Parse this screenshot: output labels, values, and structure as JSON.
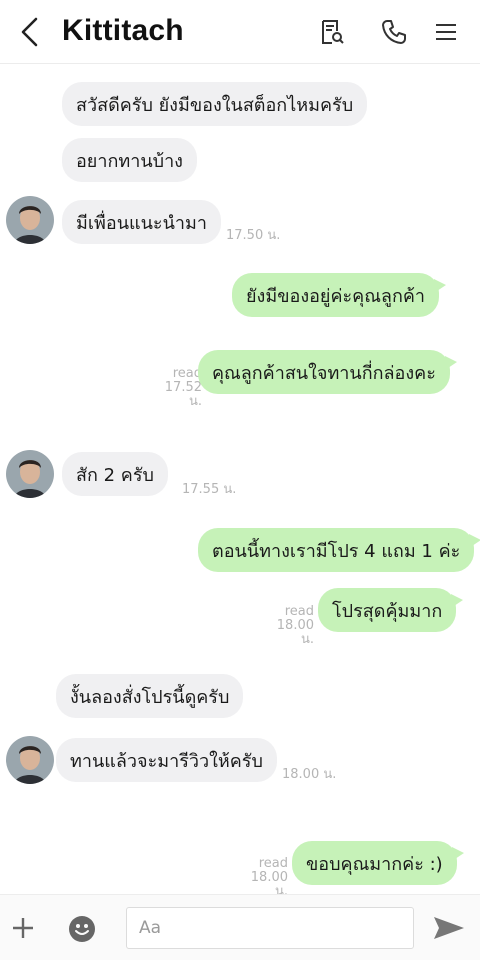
{
  "header": {
    "title": "Kittitach",
    "back_icon": "chevron-left-icon",
    "icons": [
      "notes-search-icon",
      "phone-icon",
      "menu-icon"
    ]
  },
  "messages": [
    {
      "text": "สวัสดีครับ ยังมีของในสต็อกไหมครับ",
      "side": "in"
    },
    {
      "text": "อยากทานบ้าง",
      "side": "in"
    },
    {
      "text": "มีเพื่อนแนะนำมา",
      "side": "in",
      "time": "17.50 น."
    },
    {
      "text": "ยังมีของอยู่ค่ะคุณลูกค้า",
      "side": "out"
    },
    {
      "text": "คุณลูกค้าสนใจทานกี่กล่องคะ",
      "side": "out",
      "read": "read",
      "time": "17.52 น."
    },
    {
      "text": "สัก 2 ครับ",
      "side": "in",
      "time": "17.55 น."
    },
    {
      "text": "ตอนนี้ทางเรามีโปร 4 แถม 1 ค่ะ",
      "side": "out"
    },
    {
      "text": "โปรสุดคุ้มมาก",
      "side": "out",
      "read": "read",
      "time": "18.00 น."
    },
    {
      "text": "งั้นลองสั่งโปรนี้ดูครับ",
      "side": "in"
    },
    {
      "text": "ทานแล้วจะมารีวิวให้ครับ",
      "side": "in",
      "time": "18.00 น."
    },
    {
      "text": "ขอบคุณมากค่ะ :)",
      "side": "out",
      "read": "read",
      "time": "18.00 น."
    }
  ],
  "footer": {
    "input_placeholder": "Aa",
    "add_icon": "plus-icon",
    "emoji_icon": "emoji-icon",
    "send_icon": "send-icon"
  },
  "colors": {
    "incoming_bubble": "#f0f0f2",
    "outgoing_bubble": "#c6f2b8",
    "meta_text": "#b5b5b5"
  }
}
